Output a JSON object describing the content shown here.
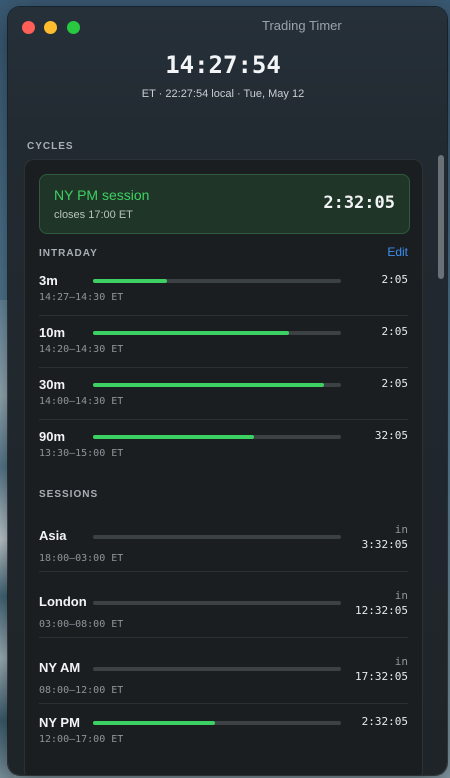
{
  "window": {
    "title": "Trading Timer"
  },
  "clock": {
    "time": "14:27:54",
    "subline": "ET · 22:27:54 local · Tue, May 12"
  },
  "cycles_label": "CYCLES",
  "active_session": {
    "name": "NY PM session",
    "closes": "closes 17:00 ET",
    "remaining": "2:32:05"
  },
  "intraday": {
    "label": "INTRADAY",
    "edit_label": "Edit",
    "rows": [
      {
        "label": "3m",
        "range": "14:27–14:30 ET",
        "value": "2:05",
        "progress": 0.3
      },
      {
        "label": "10m",
        "range": "14:20–14:30 ET",
        "value": "2:05",
        "progress": 0.79
      },
      {
        "label": "30m",
        "range": "14:00–14:30 ET",
        "value": "2:05",
        "progress": 0.93
      },
      {
        "label": "90m",
        "range": "13:30–15:00 ET",
        "value": "32:05",
        "progress": 0.65
      }
    ]
  },
  "sessions": {
    "label": "SESSIONS",
    "rows": [
      {
        "label": "Asia",
        "range": "18:00–03:00 ET",
        "prefix": "in",
        "value": "3:32:05",
        "progress": 0
      },
      {
        "label": "London",
        "range": "03:00–08:00 ET",
        "prefix": "in",
        "value": "12:32:05",
        "progress": 0
      },
      {
        "label": "NY AM",
        "range": "08:00–12:00 ET",
        "prefix": "in",
        "value": "17:32:05",
        "progress": 0
      },
      {
        "label": "NY PM",
        "range": "12:00–17:00 ET",
        "prefix": "",
        "value": "2:32:05",
        "progress": 0.49
      }
    ]
  },
  "colors": {
    "accent_green": "#3dd163",
    "link_blue": "#3b8ff0"
  }
}
